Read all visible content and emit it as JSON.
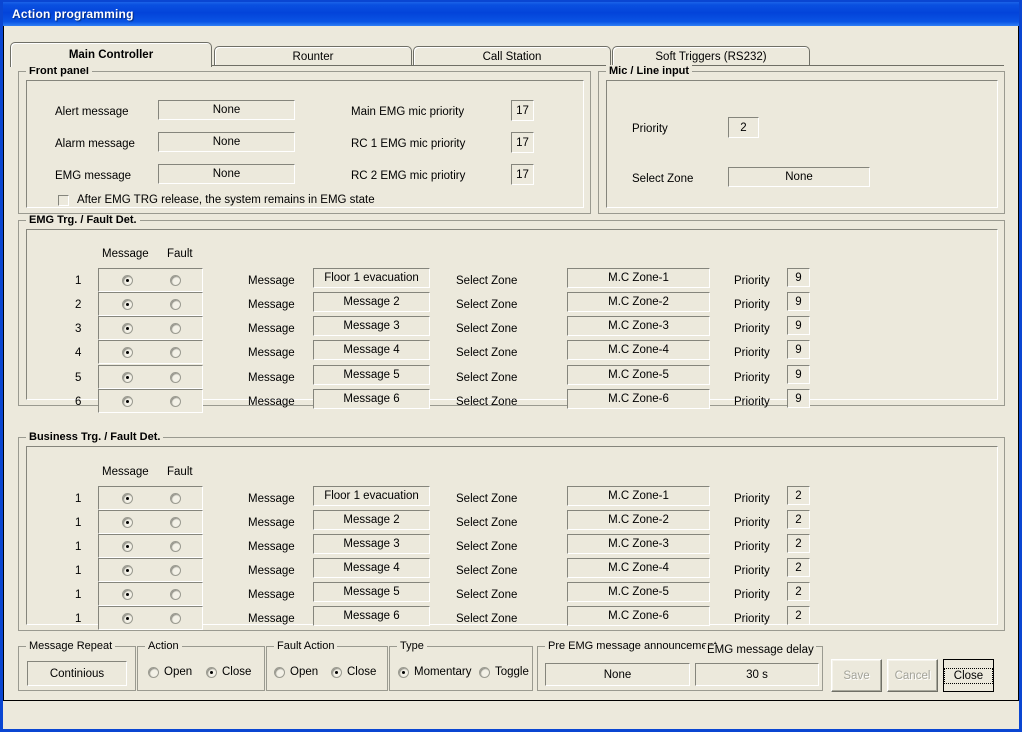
{
  "window": {
    "title": "Action programming"
  },
  "tabs": [
    {
      "label": "Main Controller",
      "active": true
    },
    {
      "label": "Rounter",
      "active": false
    },
    {
      "label": "Call Station",
      "active": false
    },
    {
      "label": "Soft Triggers (RS232)",
      "active": false
    }
  ],
  "front_panel": {
    "title": "Front panel",
    "rows": [
      {
        "label": "Alert message",
        "value": "None"
      },
      {
        "label": "Alarm message",
        "value": "None"
      },
      {
        "label": "EMG message",
        "value": "None"
      }
    ],
    "priorities": [
      {
        "label": "Main EMG mic priority",
        "value": "17"
      },
      {
        "label": "RC 1 EMG mic priority",
        "value": "17"
      },
      {
        "label": "RC 2 EMG mic priotiry",
        "value": "17"
      }
    ],
    "checkbox": {
      "label": "After EMG TRG release, the system remains in EMG state",
      "checked": false
    }
  },
  "mic_line": {
    "title": "Mic / Line input",
    "priority_label": "Priority",
    "priority_value": "2",
    "zone_label": "Select Zone",
    "zone_value": "None"
  },
  "emg": {
    "title": "EMG Trg. / Fault Det.",
    "col_message": "Message",
    "col_fault": "Fault",
    "rows": [
      {
        "index": "1",
        "message_on": true,
        "fault_on": false,
        "msg_label": "Message",
        "msg_value": "Floor 1 evacuation",
        "zone_label": "Select Zone",
        "zone_value": "M.C Zone-1",
        "priority_label": "Priority",
        "priority_value": "9"
      },
      {
        "index": "2",
        "message_on": true,
        "fault_on": false,
        "msg_label": "Message",
        "msg_value": "Message 2",
        "zone_label": "Select Zone",
        "zone_value": "M.C Zone-2",
        "priority_label": "Priority",
        "priority_value": "9"
      },
      {
        "index": "3",
        "message_on": true,
        "fault_on": false,
        "msg_label": "Message",
        "msg_value": "Message 3",
        "zone_label": "Select Zone",
        "zone_value": "M.C Zone-3",
        "priority_label": "Priority",
        "priority_value": "9"
      },
      {
        "index": "4",
        "message_on": true,
        "fault_on": false,
        "msg_label": "Message",
        "msg_value": "Message 4",
        "zone_label": "Select Zone",
        "zone_value": "M.C Zone-4",
        "priority_label": "Priority",
        "priority_value": "9"
      },
      {
        "index": "5",
        "message_on": true,
        "fault_on": false,
        "msg_label": "Message",
        "msg_value": "Message 5",
        "zone_label": "Select Zone",
        "zone_value": "M.C Zone-5",
        "priority_label": "Priority",
        "priority_value": "9"
      },
      {
        "index": "6",
        "message_on": true,
        "fault_on": false,
        "msg_label": "Message",
        "msg_value": "Message 6",
        "zone_label": "Select Zone",
        "zone_value": "M.C Zone-6",
        "priority_label": "Priority",
        "priority_value": "9"
      }
    ]
  },
  "business": {
    "title": "Business Trg. / Fault Det.",
    "col_message": "Message",
    "col_fault": "Fault",
    "rows": [
      {
        "index": "1",
        "message_on": true,
        "fault_on": false,
        "msg_label": "Message",
        "msg_value": "Floor 1 evacuation",
        "zone_label": "Select Zone",
        "zone_value": "M.C Zone-1",
        "priority_label": "Priority",
        "priority_value": "2"
      },
      {
        "index": "1",
        "message_on": true,
        "fault_on": false,
        "msg_label": "Message",
        "msg_value": "Message 2",
        "zone_label": "Select Zone",
        "zone_value": "M.C Zone-2",
        "priority_label": "Priority",
        "priority_value": "2"
      },
      {
        "index": "1",
        "message_on": true,
        "fault_on": false,
        "msg_label": "Message",
        "msg_value": "Message 3",
        "zone_label": "Select Zone",
        "zone_value": "M.C Zone-3",
        "priority_label": "Priority",
        "priority_value": "2"
      },
      {
        "index": "1",
        "message_on": true,
        "fault_on": false,
        "msg_label": "Message",
        "msg_value": "Message 4",
        "zone_label": "Select Zone",
        "zone_value": "M.C Zone-4",
        "priority_label": "Priority",
        "priority_value": "2"
      },
      {
        "index": "1",
        "message_on": true,
        "fault_on": false,
        "msg_label": "Message",
        "msg_value": "Message 5",
        "zone_label": "Select Zone",
        "zone_value": "M.C Zone-5",
        "priority_label": "Priority",
        "priority_value": "2"
      },
      {
        "index": "1",
        "message_on": true,
        "fault_on": false,
        "msg_label": "Message",
        "msg_value": "Message 6",
        "zone_label": "Select Zone",
        "zone_value": "M.C Zone-6",
        "priority_label": "Priority",
        "priority_value": "2"
      }
    ]
  },
  "footer": {
    "message_repeat": {
      "title": "Message Repeat",
      "value": "Continious"
    },
    "action": {
      "title": "Action",
      "open_label": "Open",
      "close_label": "Close",
      "selected": "Close"
    },
    "fault_action": {
      "title": "Fault Action",
      "open_label": "Open",
      "close_label": "Close",
      "selected": "Close"
    },
    "type": {
      "title": "Type",
      "momentary_label": "Momentary",
      "toggle_label": "Toggle",
      "selected": "Momentary"
    },
    "pre_emg": {
      "title": "Pre EMG message announcement",
      "value": "None"
    },
    "emg_delay": {
      "title": "EMG message delay",
      "value": "30 s"
    },
    "buttons": {
      "save": "Save",
      "cancel": "Cancel",
      "close": "Close"
    }
  }
}
